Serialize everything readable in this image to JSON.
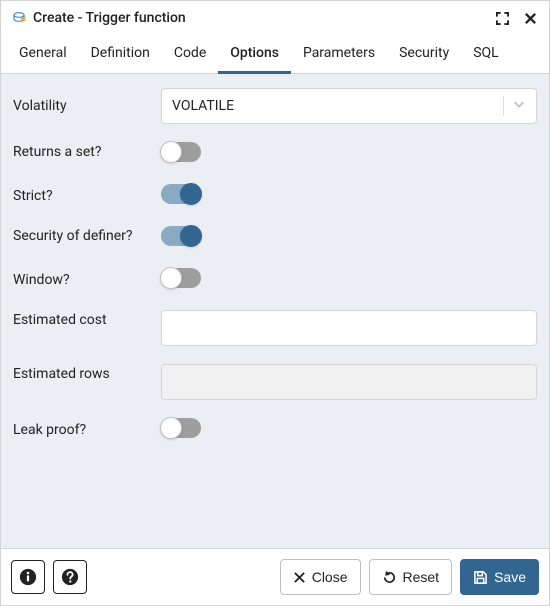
{
  "window": {
    "title": "Create - Trigger function"
  },
  "tabs": {
    "general": "General",
    "definition": "Definition",
    "code": "Code",
    "options": "Options",
    "parameters": "Parameters",
    "security": "Security",
    "sql": "SQL",
    "active": "options"
  },
  "form": {
    "volatility": {
      "label": "Volatility",
      "value": "VOLATILE"
    },
    "returns_set": {
      "label": "Returns a set?",
      "value": false
    },
    "strict": {
      "label": "Strict?",
      "value": true
    },
    "sec_definer": {
      "label": "Security of definer?",
      "value": true
    },
    "window": {
      "label": "Window?",
      "value": false
    },
    "est_cost": {
      "label": "Estimated cost",
      "value": ""
    },
    "est_rows": {
      "label": "Estimated rows",
      "value": "",
      "disabled": true
    },
    "leak_proof": {
      "label": "Leak proof?",
      "value": false
    }
  },
  "footer": {
    "close": "Close",
    "reset": "Reset",
    "save": "Save"
  }
}
